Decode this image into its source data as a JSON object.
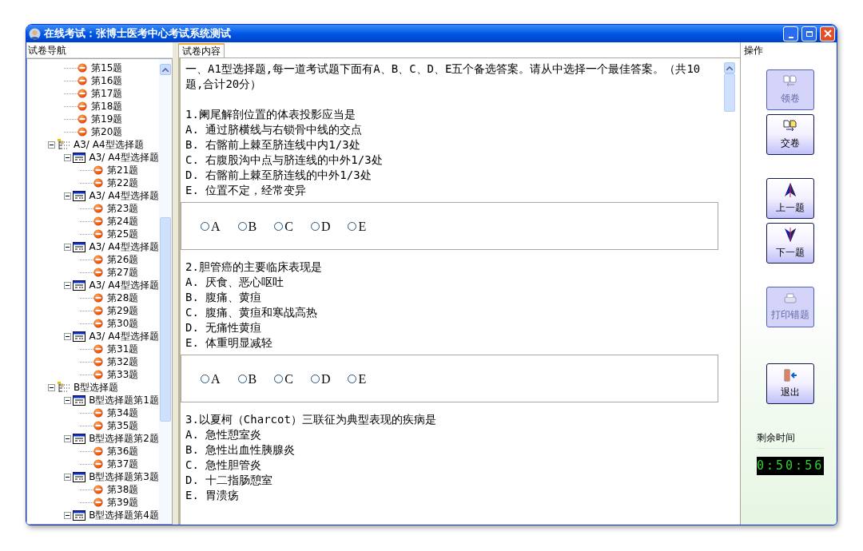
{
  "window": {
    "title": "在线考试：张博士医考中心考试系统测试"
  },
  "nav": {
    "title": "试卷导航",
    "tree": [
      {
        "kind": "section",
        "children": [
          {
            "label": "第15题",
            "kind": "question"
          },
          {
            "label": "第16题",
            "kind": "question"
          },
          {
            "label": "第17题",
            "kind": "question"
          },
          {
            "label": "第18题",
            "kind": "question"
          },
          {
            "label": "第19题",
            "kind": "question"
          },
          {
            "label": "第20题",
            "kind": "question"
          }
        ]
      },
      {
        "label": "A3/ A4型选择题",
        "kind": "section",
        "expanded": true,
        "children": [
          {
            "label": "A3/ A4型选择题",
            "kind": "group",
            "expanded": true,
            "children": [
              {
                "label": "第21题",
                "kind": "question"
              },
              {
                "label": "第22题",
                "kind": "question"
              }
            ]
          },
          {
            "label": "A3/ A4型选择题",
            "kind": "group",
            "expanded": true,
            "children": [
              {
                "label": "第23题",
                "kind": "question"
              },
              {
                "label": "第24题",
                "kind": "question"
              },
              {
                "label": "第25题",
                "kind": "question"
              }
            ]
          },
          {
            "label": "A3/ A4型选择题",
            "kind": "group",
            "expanded": true,
            "children": [
              {
                "label": "第26题",
                "kind": "question"
              },
              {
                "label": "第27题",
                "kind": "question"
              }
            ]
          },
          {
            "label": "A3/ A4型选择题",
            "kind": "group",
            "expanded": true,
            "children": [
              {
                "label": "第28题",
                "kind": "question"
              },
              {
                "label": "第29题",
                "kind": "question"
              },
              {
                "label": "第30题",
                "kind": "question"
              }
            ]
          },
          {
            "label": "A3/ A4型选择题",
            "kind": "group",
            "expanded": true,
            "children": [
              {
                "label": "第31题",
                "kind": "question"
              },
              {
                "label": "第32题",
                "kind": "question"
              },
              {
                "label": "第33题",
                "kind": "question"
              }
            ]
          }
        ]
      },
      {
        "label": "B型选择题",
        "kind": "section",
        "expanded": true,
        "children": [
          {
            "label": "B型选择题第1题",
            "kind": "group",
            "expanded": true,
            "children": [
              {
                "label": "第34题",
                "kind": "question"
              },
              {
                "label": "第35题",
                "kind": "question"
              }
            ]
          },
          {
            "label": "B型选择题第2题",
            "kind": "group",
            "expanded": true,
            "children": [
              {
                "label": "第36题",
                "kind": "question"
              },
              {
                "label": "第37题",
                "kind": "question"
              }
            ]
          },
          {
            "label": "B型选择题第3题",
            "kind": "group",
            "expanded": true,
            "children": [
              {
                "label": "第38题",
                "kind": "question"
              },
              {
                "label": "第39题",
                "kind": "question"
              }
            ]
          },
          {
            "label": "B型选择题第4题",
            "kind": "group",
            "expanded": true
          }
        ]
      }
    ]
  },
  "content": {
    "tab": {
      "label": "试卷内容",
      "selected": true
    },
    "intro": "一、A1型选择题,每一道考试题下面有A、B、C、D、E五个备选答案。请从中选择一个最佳答案。（共10题,合计20分）",
    "questions": [
      {
        "title": "1.阑尾解剖位置的体表投影应当是",
        "choices": [
          "A. 通过脐横线与右锁骨中线的交点",
          "B. 右髂前上棘至脐连线中内1/3处",
          "C. 右腹股沟中点与脐连线的中外1/3处",
          "D. 右髂前上棘至脐连线的中外1/3处",
          "E. 位置不定，经常变异"
        ],
        "answers": [
          {
            "label": "A",
            "selected": false
          },
          {
            "label": "B",
            "selected": false
          },
          {
            "label": "C",
            "selected": false
          },
          {
            "label": "D",
            "selected": false
          },
          {
            "label": "E",
            "selected": false
          }
        ]
      },
      {
        "title": "2.胆管癌的主要临床表现是",
        "choices": [
          "A. 厌食、恶心呕吐",
          "B. 腹痛、黄疸",
          "C. 腹痛、黄疸和寒战高热",
          "D. 无痛性黄疸",
          "E. 体重明显减轻"
        ],
        "answers": [
          {
            "label": "A",
            "selected": false
          },
          {
            "label": "B",
            "selected": false
          },
          {
            "label": "C",
            "selected": false
          },
          {
            "label": "D",
            "selected": false
          },
          {
            "label": "E",
            "selected": false
          }
        ]
      },
      {
        "title": "3.以夏柯（Charcot）三联征为典型表现的疾病是",
        "choices": [
          "A. 急性憩室炎",
          "B. 急性出血性胰腺炎",
          "C. 急性胆管炎",
          "D. 十二指肠憩室",
          "E. 胃溃疡"
        ]
      }
    ]
  },
  "actions": {
    "title": "操作",
    "groups": [
      [
        {
          "label": "领卷",
          "disabled": true
        },
        {
          "label": "交卷",
          "disabled": false
        }
      ],
      [
        {
          "label": "上一题",
          "disabled": false
        },
        {
          "label": "下一题",
          "disabled": false
        }
      ],
      [
        {
          "label": "打印错题",
          "disabled": true
        }
      ],
      [
        {
          "label": "退出",
          "disabled": false
        }
      ]
    ]
  },
  "timer": {
    "label": "剩余时间",
    "value": "0:50:56"
  }
}
